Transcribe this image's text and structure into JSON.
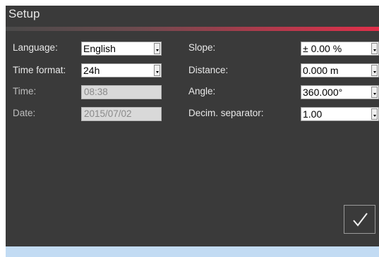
{
  "window": {
    "title": "Setup"
  },
  "left": {
    "language_label": "Language:",
    "language_value": "English",
    "time_format_label": "Time format:",
    "time_format_value": "24h",
    "time_label": "Time:",
    "time_value": "08:38",
    "date_label": "Date:",
    "date_value": "2015/07/02"
  },
  "right": {
    "slope_label": "Slope:",
    "slope_value": "± 0.00 %",
    "distance_label": "Distance:",
    "distance_value": "0.000 m",
    "angle_label": "Angle:",
    "angle_value": "360.000°",
    "decimal_label": "Decim. separator:",
    "decimal_value": "1.00"
  },
  "actions": {
    "confirm_icon": "checkmark-icon"
  },
  "colors": {
    "panel_bg": "#3a3a3a",
    "accent": "#e0304a",
    "statusbar": "#c2dbf3"
  }
}
